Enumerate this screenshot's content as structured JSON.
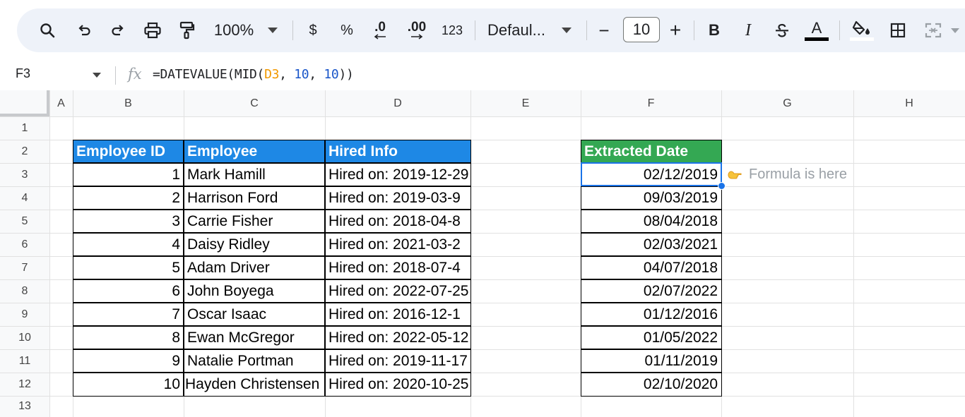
{
  "toolbar": {
    "zoom": "100%",
    "currency": "$",
    "percent": "%",
    "decrease_decimal": ".0",
    "increase_decimal": ".00",
    "number_format": "123",
    "font": "Defaul...",
    "minus": "−",
    "font_size": "10",
    "plus": "+",
    "bold": "B",
    "italic": "I",
    "text_color_letter": "A"
  },
  "formula_bar": {
    "cell_ref": "F3",
    "fx": "fx",
    "f_start": "=DATEVALUE(MID(",
    "f_ref": "D3",
    "f_sep1": ", ",
    "f_num1": "10",
    "f_sep2": ", ",
    "f_num2": "10",
    "f_end": "))"
  },
  "columns": [
    "A",
    "B",
    "C",
    "D",
    "E",
    "F",
    "G",
    "H"
  ],
  "rows": [
    "1",
    "2",
    "3",
    "4",
    "5",
    "6",
    "7",
    "8",
    "9",
    "10",
    "11",
    "12",
    "13"
  ],
  "table": {
    "headers": [
      "Employee ID",
      "Employee",
      "Hired Info"
    ],
    "rows": [
      {
        "id": "1",
        "name": "Mark Hamill",
        "info": "Hired on: 2019-12-29"
      },
      {
        "id": "2",
        "name": "Harrison Ford",
        "info": "Hired on: 2019-03-9"
      },
      {
        "id": "3",
        "name": "Carrie Fisher",
        "info": "Hired on: 2018-04-8"
      },
      {
        "id": "4",
        "name": "Daisy Ridley",
        "info": "Hired on: 2021-03-2"
      },
      {
        "id": "5",
        "name": "Adam Driver",
        "info": "Hired on: 2018-07-4"
      },
      {
        "id": "6",
        "name": "John Boyega",
        "info": "Hired on: 2022-07-25"
      },
      {
        "id": "7",
        "name": "Oscar Isaac",
        "info": "Hired on: 2016-12-1"
      },
      {
        "id": "8",
        "name": "Ewan McGregor",
        "info": "Hired on: 2022-05-12"
      },
      {
        "id": "9",
        "name": "Natalie Portman",
        "info": "Hired on: 2019-11-17"
      },
      {
        "id": "10",
        "name": "Hayden Christensen",
        "info": "Hired on: 2020-10-25"
      }
    ]
  },
  "extracted": {
    "header": "Extracted Date",
    "values": [
      "02/12/2019",
      "09/03/2019",
      "08/04/2018",
      "02/03/2021",
      "04/07/2018",
      "02/07/2022",
      "01/12/2016",
      "01/05/2022",
      "01/11/2019",
      "02/10/2020"
    ]
  },
  "annotation": "Formula is here",
  "colors": {
    "blue_header": "#1e88e5",
    "green_header": "#34a853",
    "selection": "#1a73e8",
    "formula_ref": "#f29900",
    "formula_number": "#1a56c9"
  }
}
